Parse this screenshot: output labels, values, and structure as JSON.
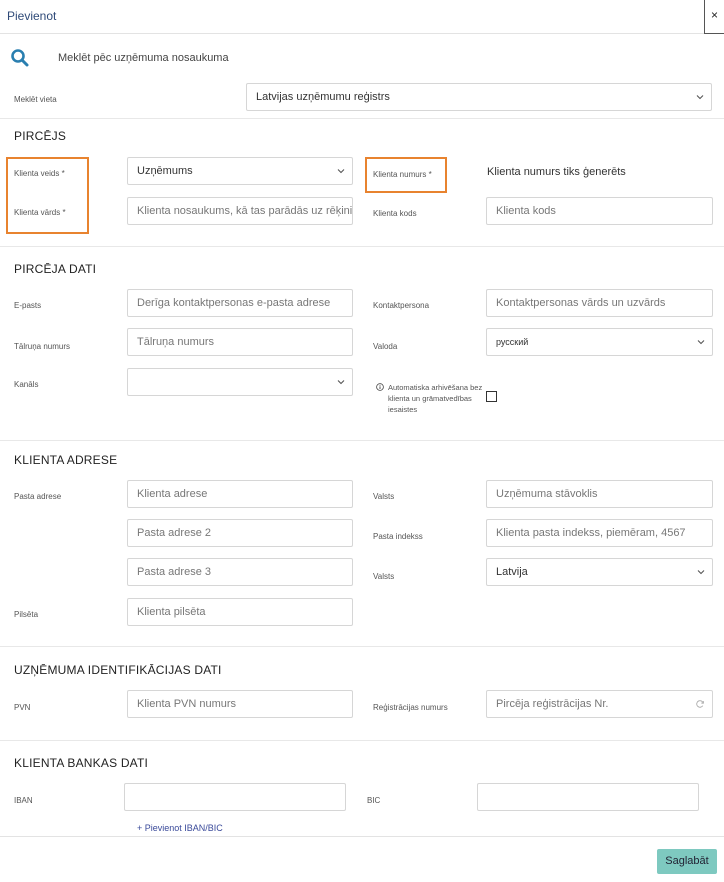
{
  "header": {
    "title": "Pievienot",
    "close_glyph": "×"
  },
  "search": {
    "icon": "search-icon",
    "label": "Meklēt pēc uzņēmuma nosaukuma",
    "place_label": "Meklēt vieta",
    "place_value": "Latvijas uzņēmumu reģistrs"
  },
  "buyer": {
    "section_title": "PIRCĒJS",
    "client_type_label": "Klienta veids *",
    "client_type_value": "Uzņēmums",
    "client_name_label": "Klienta vārds *",
    "client_name_placeholder": "Klienta nosaukums, kā tas parādās uz rēķiniem",
    "client_number_label": "Klienta numurs *",
    "client_number_value": "Klienta numurs tiks ģenerēts",
    "client_code_label": "Klienta kods",
    "client_code_placeholder": "Klienta kods"
  },
  "buyer_data": {
    "section_title": "PIRCĒJA DATI",
    "email_label": "E-pasts",
    "email_placeholder": "Derīga kontaktpersonas e-pasta adrese",
    "contact_label": "Kontaktpersona",
    "contact_placeholder": "Kontaktpersonas vārds un uzvārds",
    "phone_label": "Tālruņa numurs",
    "phone_placeholder": "Tālruņa numurs",
    "language_label": "Valoda",
    "language_value": "русский",
    "channel_label": "Kanāls",
    "channel_value": "",
    "auto_archive_text": "Automatiska arhivēšana bez klienta un grāmatvedības iesaistes"
  },
  "address": {
    "section_title": "KLIENTA ADRESE",
    "postal_label": "Pasta adrese",
    "address1_placeholder": "Klienta adrese",
    "address2_placeholder": "Pasta adrese 2",
    "address3_placeholder": "Pasta adrese 3",
    "state_label": "Valsts",
    "state_placeholder": "Uzņēmuma stāvoklis",
    "postcode_label": "Pasta indekss",
    "postcode_placeholder": "Klienta pasta indekss, piemēram, 4567",
    "country_label": "Valsts",
    "country_value": "Latvija",
    "city_label": "Pilsēta",
    "city_placeholder": "Klienta pilsēta"
  },
  "company_id": {
    "section_title": "UZŅĒMUMA IDENTIFIKĀCIJAS DATI",
    "vat_label": "PVN",
    "vat_placeholder": "Klienta PVN numurs",
    "reg_label": "Reģistrācijas numurs",
    "reg_placeholder": "Pircēja reģistrācijas Nr."
  },
  "bank": {
    "section_title": "KLIENTA BANKAS DATI",
    "iban_label": "IBAN",
    "iban_value": "",
    "bic_label": "BIC",
    "bic_value": "",
    "add_link": "+ Pievienot IBAN/BIC"
  },
  "footer": {
    "save_label": "Saglabāt"
  },
  "colors": {
    "highlight": "#e8832f",
    "save_button": "#7ec9c0",
    "search_icon": "#2a7fb0",
    "title": "#2f4a78"
  }
}
